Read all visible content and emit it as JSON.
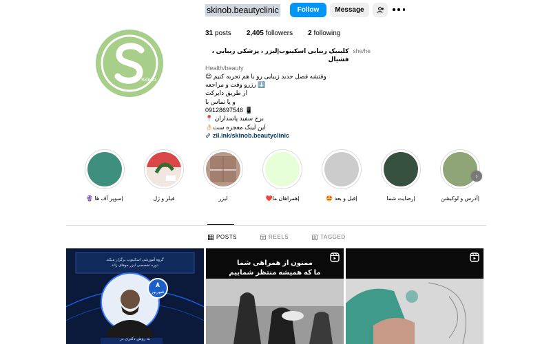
{
  "profile": {
    "username": "skinob.beautyclinic",
    "follow_label": "Follow",
    "message_label": "Message",
    "avatar_text": "Skinob",
    "stats": {
      "posts": "31",
      "posts_label": "posts",
      "followers": "2,405",
      "followers_label": "followers",
      "following": "2",
      "following_label": "following"
    },
    "bio": {
      "full_name": "کلینیک زیبایی اسکینوب|لیزر ، پزشکی زیبایی ، فشیال",
      "pronouns": "she/he",
      "category": "Health/beauty",
      "lines": [
        "وقتشه فصل جدید زیبایی رو با هم تجربه کنیم 😊",
        "⬇️ رزرو وقت و مراجعه",
        "از طریق دایرکت",
        "و یا تماس با",
        "09128697546 📱",
        "برج سفید پاسداران 📍",
        "این لینک معجزه ست👌🏻",
        "zil.ink/skinob.beautyclinic"
      ]
    }
  },
  "highlights": [
    {
      "label": "|سوپر آف ها 🔮",
      "color": "#3f8f7f"
    },
    {
      "label": "فیلر و ژل",
      "color": "#c84a4a"
    },
    {
      "label": "لیزر",
      "color": "#a88a7a"
    },
    {
      "label": "|همراهان ما❤️",
      "color": "#e6ffd9"
    },
    {
      "label": "|قبل و بعد 🤩",
      "color": "#cccccc"
    },
    {
      "label": "|رضایت شما",
      "color": "#36513f"
    },
    {
      "label": "|آدرس و لوکیشن",
      "color": "#8fa577"
    }
  ],
  "tabs": [
    {
      "label": "POSTS",
      "icon": "grid-icon"
    },
    {
      "label": "REELS",
      "icon": "reels-icon"
    },
    {
      "label": "TAGGED",
      "icon": "tagged-icon"
    }
  ],
  "posts": {
    "p1": {
      "header_line1": "گروه آموزشی اسکینوب برگزار میکند",
      "header_line2": "دوره تخصصی لیزر موهای زائد",
      "badge_number": "۸",
      "badge_text": "شهریور",
      "footer_text": "به روش دکتری در"
    },
    "p2": {
      "line1": "ممنون از همراهی شما",
      "line2": "ما که همیشه منتظر شماییم"
    }
  },
  "colors": {
    "follow_blue": "#0095f6",
    "link_blue": "#00376b",
    "secondary_text": "#737373",
    "avatar_green": "#a8cf8a"
  }
}
